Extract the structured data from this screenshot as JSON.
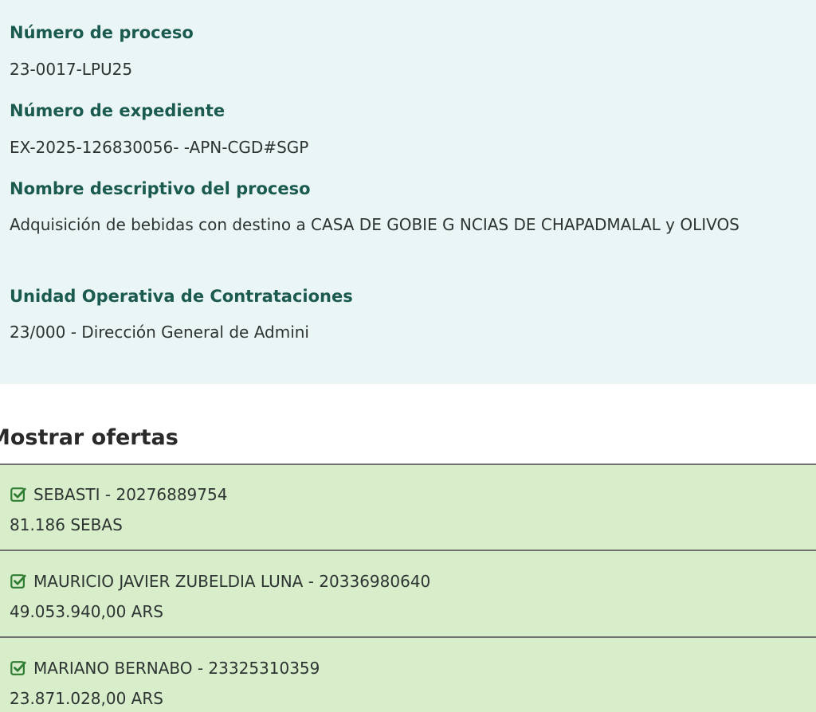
{
  "process_info": {
    "numero_proceso": {
      "label": "Número de proceso",
      "value": "23-0017-LPU25"
    },
    "numero_expediente": {
      "label": "Número de expediente",
      "value": "EX-2025-126830056-   -APN-CGD#SGP"
    },
    "nombre_descriptivo": {
      "label": "Nombre descriptivo del proceso",
      "value": "Adquisición de bebidas con destino a CASA DE GOBIE G   NCIAS DE CHAPADMALAL y OLIVOS"
    },
    "unidad_operativa": {
      "label": "Unidad Operativa de Contrataciones",
      "value": "23/000 - Dirección General de Admini"
    }
  },
  "offers": {
    "title": "Mostrar ofertas",
    "items": [
      {
        "name": "SEBASTI  - 20276889754",
        "amount": "81.186 SEBAS"
      },
      {
        "name": "MAURICIO JAVIER ZUBELDIA LUNA - 20336980640",
        "amount": "49.053.940,00 ARS"
      },
      {
        "name": "MARIANO BERNABO - 23325310359",
        "amount": "23.871.028,00 ARS"
      }
    ]
  },
  "icons": {
    "offer_check": "checkbox-checked-icon"
  },
  "colors": {
    "info_panel_bg": "#eaf6f6",
    "label_color": "#1b5a4f",
    "offers_bg": "#d8edc9",
    "check_color": "#2e7d32"
  }
}
